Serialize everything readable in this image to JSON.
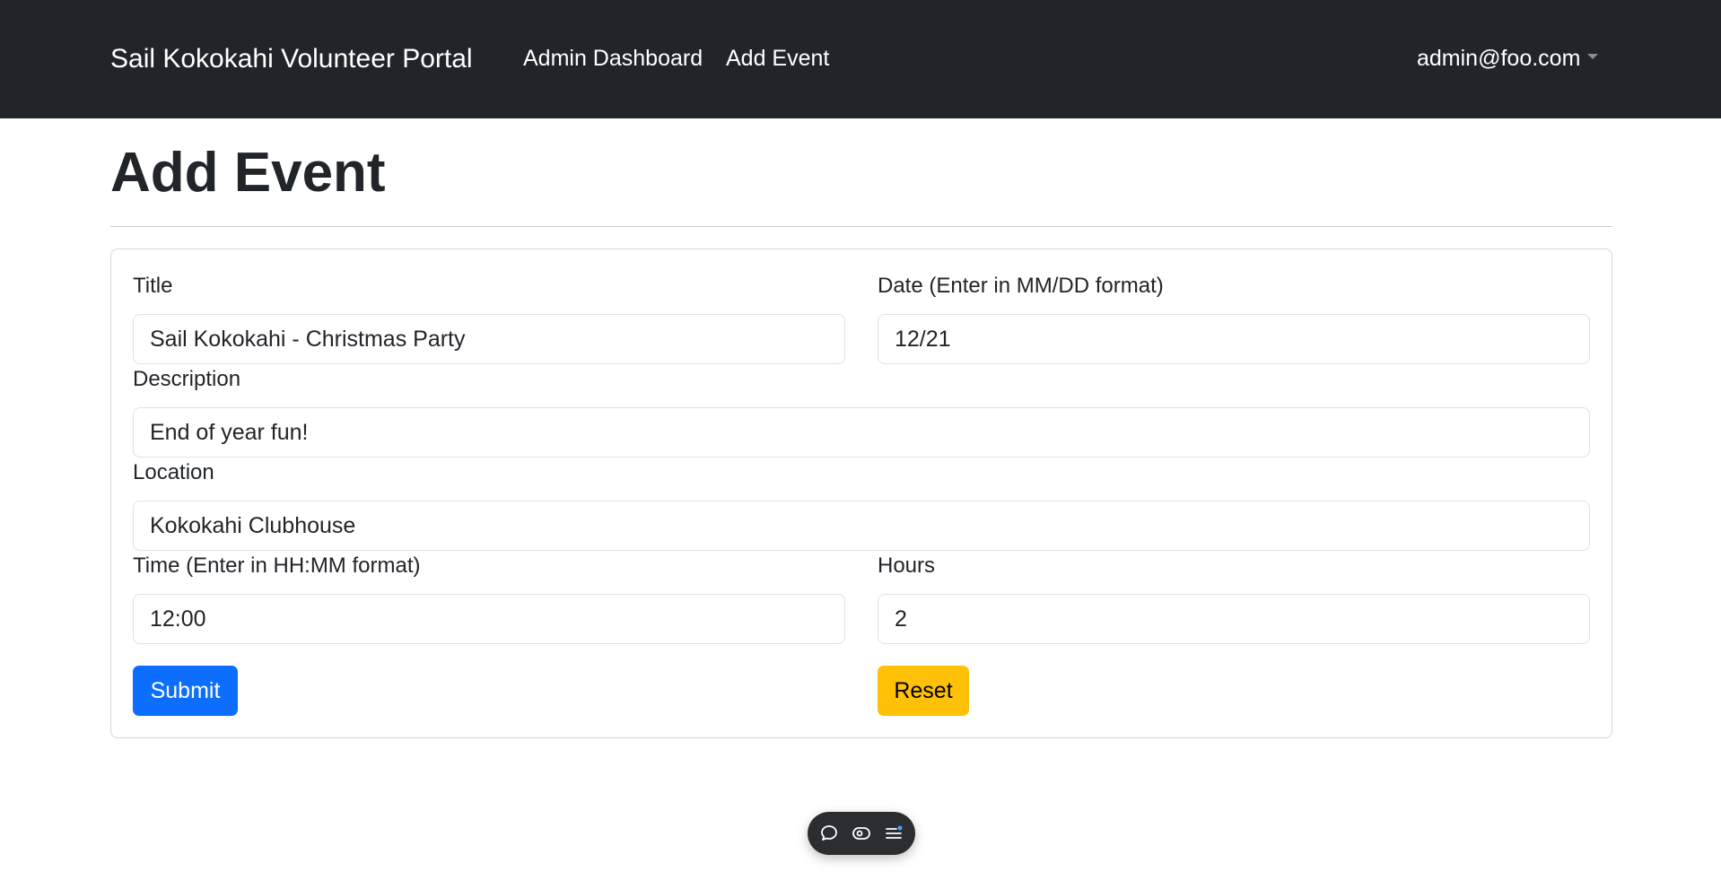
{
  "navbar": {
    "brand": "Sail Kokokahi Volunteer Portal",
    "links": [
      {
        "label": "Admin Dashboard"
      },
      {
        "label": "Add Event"
      }
    ],
    "user": "admin@foo.com"
  },
  "page": {
    "title": "Add Event"
  },
  "form": {
    "title": {
      "label": "Title",
      "value": "Sail Kokokahi - Christmas Party"
    },
    "date": {
      "label": "Date (Enter in MM/DD format)",
      "value": "12/21"
    },
    "description": {
      "label": "Description",
      "value": "End of year fun!"
    },
    "location": {
      "label": "Location",
      "value": "Kokokahi Clubhouse"
    },
    "time": {
      "label": "Time (Enter in HH:MM format)",
      "value": "12:00"
    },
    "hours": {
      "label": "Hours",
      "value": "2"
    },
    "submit_label": "Submit",
    "reset_label": "Reset"
  },
  "colors": {
    "navbar_bg": "#212529",
    "primary": "#0d6efd",
    "warning": "#ffc107"
  },
  "toolbar": {
    "icons": [
      "chat-icon",
      "eye-icon",
      "menu-icon"
    ]
  }
}
